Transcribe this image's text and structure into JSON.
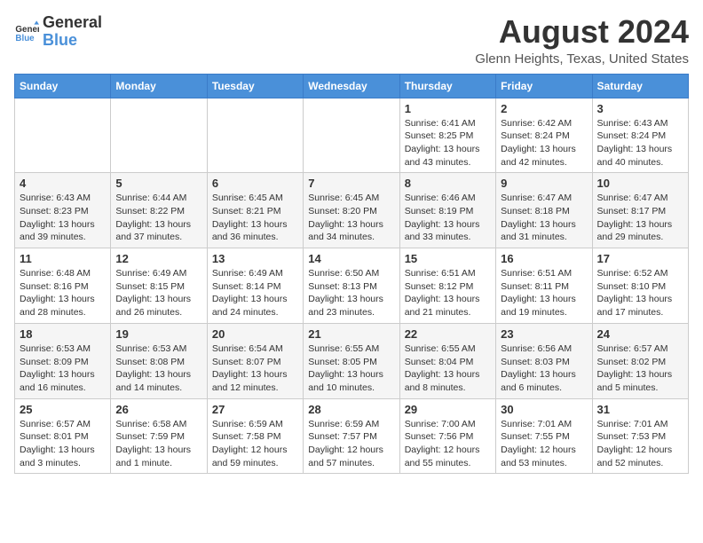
{
  "logo": {
    "line1": "General",
    "line2": "Blue"
  },
  "title": "August 2024",
  "subtitle": "Glenn Heights, Texas, United States",
  "days_of_week": [
    "Sunday",
    "Monday",
    "Tuesday",
    "Wednesday",
    "Thursday",
    "Friday",
    "Saturday"
  ],
  "weeks": [
    [
      {
        "day": "",
        "info": ""
      },
      {
        "day": "",
        "info": ""
      },
      {
        "day": "",
        "info": ""
      },
      {
        "day": "",
        "info": ""
      },
      {
        "day": "1",
        "info": "Sunrise: 6:41 AM\nSunset: 8:25 PM\nDaylight: 13 hours\nand 43 minutes."
      },
      {
        "day": "2",
        "info": "Sunrise: 6:42 AM\nSunset: 8:24 PM\nDaylight: 13 hours\nand 42 minutes."
      },
      {
        "day": "3",
        "info": "Sunrise: 6:43 AM\nSunset: 8:24 PM\nDaylight: 13 hours\nand 40 minutes."
      }
    ],
    [
      {
        "day": "4",
        "info": "Sunrise: 6:43 AM\nSunset: 8:23 PM\nDaylight: 13 hours\nand 39 minutes."
      },
      {
        "day": "5",
        "info": "Sunrise: 6:44 AM\nSunset: 8:22 PM\nDaylight: 13 hours\nand 37 minutes."
      },
      {
        "day": "6",
        "info": "Sunrise: 6:45 AM\nSunset: 8:21 PM\nDaylight: 13 hours\nand 36 minutes."
      },
      {
        "day": "7",
        "info": "Sunrise: 6:45 AM\nSunset: 8:20 PM\nDaylight: 13 hours\nand 34 minutes."
      },
      {
        "day": "8",
        "info": "Sunrise: 6:46 AM\nSunset: 8:19 PM\nDaylight: 13 hours\nand 33 minutes."
      },
      {
        "day": "9",
        "info": "Sunrise: 6:47 AM\nSunset: 8:18 PM\nDaylight: 13 hours\nand 31 minutes."
      },
      {
        "day": "10",
        "info": "Sunrise: 6:47 AM\nSunset: 8:17 PM\nDaylight: 13 hours\nand 29 minutes."
      }
    ],
    [
      {
        "day": "11",
        "info": "Sunrise: 6:48 AM\nSunset: 8:16 PM\nDaylight: 13 hours\nand 28 minutes."
      },
      {
        "day": "12",
        "info": "Sunrise: 6:49 AM\nSunset: 8:15 PM\nDaylight: 13 hours\nand 26 minutes."
      },
      {
        "day": "13",
        "info": "Sunrise: 6:49 AM\nSunset: 8:14 PM\nDaylight: 13 hours\nand 24 minutes."
      },
      {
        "day": "14",
        "info": "Sunrise: 6:50 AM\nSunset: 8:13 PM\nDaylight: 13 hours\nand 23 minutes."
      },
      {
        "day": "15",
        "info": "Sunrise: 6:51 AM\nSunset: 8:12 PM\nDaylight: 13 hours\nand 21 minutes."
      },
      {
        "day": "16",
        "info": "Sunrise: 6:51 AM\nSunset: 8:11 PM\nDaylight: 13 hours\nand 19 minutes."
      },
      {
        "day": "17",
        "info": "Sunrise: 6:52 AM\nSunset: 8:10 PM\nDaylight: 13 hours\nand 17 minutes."
      }
    ],
    [
      {
        "day": "18",
        "info": "Sunrise: 6:53 AM\nSunset: 8:09 PM\nDaylight: 13 hours\nand 16 minutes."
      },
      {
        "day": "19",
        "info": "Sunrise: 6:53 AM\nSunset: 8:08 PM\nDaylight: 13 hours\nand 14 minutes."
      },
      {
        "day": "20",
        "info": "Sunrise: 6:54 AM\nSunset: 8:07 PM\nDaylight: 13 hours\nand 12 minutes."
      },
      {
        "day": "21",
        "info": "Sunrise: 6:55 AM\nSunset: 8:05 PM\nDaylight: 13 hours\nand 10 minutes."
      },
      {
        "day": "22",
        "info": "Sunrise: 6:55 AM\nSunset: 8:04 PM\nDaylight: 13 hours\nand 8 minutes."
      },
      {
        "day": "23",
        "info": "Sunrise: 6:56 AM\nSunset: 8:03 PM\nDaylight: 13 hours\nand 6 minutes."
      },
      {
        "day": "24",
        "info": "Sunrise: 6:57 AM\nSunset: 8:02 PM\nDaylight: 13 hours\nand 5 minutes."
      }
    ],
    [
      {
        "day": "25",
        "info": "Sunrise: 6:57 AM\nSunset: 8:01 PM\nDaylight: 13 hours\nand 3 minutes."
      },
      {
        "day": "26",
        "info": "Sunrise: 6:58 AM\nSunset: 7:59 PM\nDaylight: 13 hours\nand 1 minute."
      },
      {
        "day": "27",
        "info": "Sunrise: 6:59 AM\nSunset: 7:58 PM\nDaylight: 12 hours\nand 59 minutes."
      },
      {
        "day": "28",
        "info": "Sunrise: 6:59 AM\nSunset: 7:57 PM\nDaylight: 12 hours\nand 57 minutes."
      },
      {
        "day": "29",
        "info": "Sunrise: 7:00 AM\nSunset: 7:56 PM\nDaylight: 12 hours\nand 55 minutes."
      },
      {
        "day": "30",
        "info": "Sunrise: 7:01 AM\nSunset: 7:55 PM\nDaylight: 12 hours\nand 53 minutes."
      },
      {
        "day": "31",
        "info": "Sunrise: 7:01 AM\nSunset: 7:53 PM\nDaylight: 12 hours\nand 52 minutes."
      }
    ]
  ]
}
